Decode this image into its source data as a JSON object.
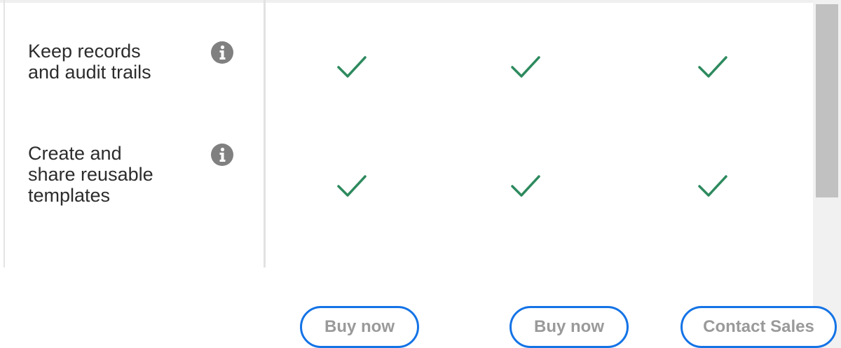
{
  "rows": [
    {
      "label": "Keep records\nand audit trails",
      "info_icon": "info-circle-icon",
      "checks": [
        "check-icon",
        "check-icon",
        "check-icon"
      ]
    },
    {
      "label": "Create and\nshare reusable\ntemplates",
      "info_icon": "info-circle-icon",
      "checks": [
        "check-icon",
        "check-icon",
        "check-icon"
      ]
    }
  ],
  "actions": {
    "plan1": "Buy now",
    "plan2": "Buy now",
    "plan3": "Contact Sales"
  },
  "colors": {
    "check": "#2d8a5e",
    "info_icon": "#808080",
    "button_border": "#1473e6",
    "button_text": "#9a9a9a"
  }
}
